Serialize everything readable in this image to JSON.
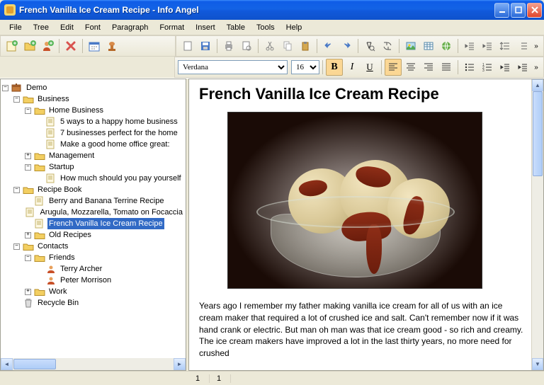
{
  "window": {
    "title": "French Vanilla Ice Cream Recipe - Info Angel"
  },
  "menubar": [
    "File",
    "Tree",
    "Edit",
    "Font",
    "Paragraph",
    "Format",
    "Insert",
    "Table",
    "Tools",
    "Help"
  ],
  "format": {
    "font": "Verdana",
    "size": "16"
  },
  "tree": {
    "root": "Demo",
    "nodes": {
      "business": "Business",
      "home_business": "Home Business",
      "hb1": "5 ways to a happy home business",
      "hb2": "7 businesses perfect for the home",
      "hb3": "Make a good home office great:",
      "management": "Management",
      "startup": "Startup",
      "su1": "How much should you pay yourself",
      "recipe_book": "Recipe Book",
      "rb1": "Berry and Banana Terrine Recipe",
      "rb2": "Arugula, Mozzarella, Tomato on Focaccia",
      "rb3": "French Vanilla Ice Cream Recipe",
      "old_recipes": "Old Recipes",
      "contacts": "Contacts",
      "friends": "Friends",
      "fr1": "Terry Archer",
      "fr2": "Peter Morrison",
      "work": "Work",
      "recycle": "Recycle Bin"
    }
  },
  "document": {
    "title": "French Vanilla Ice Cream Recipe",
    "body": "Years ago I remember my father making vanilla ice cream for all of us with an ice cream maker that required a lot of crushed ice and salt. Can't remember now if it was hand crank or electric. But man oh man was that ice cream good - so rich and creamy. The ice cream makers have improved a lot in the last thirty years, no more need for crushed"
  },
  "status": {
    "a": "1",
    "b": "1"
  }
}
